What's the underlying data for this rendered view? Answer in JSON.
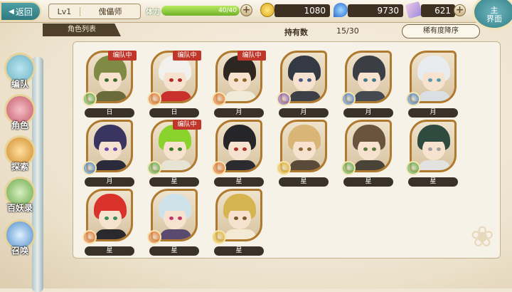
{
  "header": {
    "back_label": "返回",
    "level": "Lv1",
    "player_name": "傀儡师",
    "stamina_label": "体力",
    "stamina_value": "40/40",
    "stamina_fraction": 1.0,
    "gold": "1080",
    "gems": "9730",
    "tickets": "621",
    "home_label_1": "主",
    "home_label_2": "界面"
  },
  "tabs": {
    "list_label": "角色列表",
    "owned_label": "持有数",
    "owned_value": "15/30",
    "sort_label": "稀有度降序"
  },
  "sidebar": {
    "items": [
      {
        "label": "编队",
        "icon": "team-icon"
      },
      {
        "label": "角色",
        "icon": "character-icon"
      },
      {
        "label": "探索",
        "icon": "explore-icon"
      },
      {
        "label": "百妖录",
        "icon": "bestiary-icon"
      },
      {
        "label": "召唤",
        "icon": "summon-icon"
      }
    ]
  },
  "in_team_label": "编队中",
  "characters": [
    {
      "name": "日",
      "in_team": true,
      "hair": "#7f8a45",
      "eye": "#3b6b2a",
      "attr": "#4aa63a",
      "cloth": "#6b6a3a"
    },
    {
      "name": "日",
      "in_team": true,
      "hair": "#f2f0ec",
      "eye": "#b22a2a",
      "attr": "#e06a1e",
      "cloth": "#c9302c"
    },
    {
      "name": "月",
      "in_team": true,
      "hair": "#2e2620",
      "eye": "#8a6a2a",
      "attr": "#e06a1e",
      "cloth": "#f0ead8"
    },
    {
      "name": "月",
      "in_team": false,
      "hair": "#343a44",
      "eye": "#4a5a8a",
      "attr": "#7a4ab0",
      "cloth": "#3c3f46"
    },
    {
      "name": "月",
      "in_team": false,
      "hair": "#3b3e44",
      "eye": "#3e7a8a",
      "attr": "#3a7ac6",
      "cloth": "#444a50"
    },
    {
      "name": "月",
      "in_team": false,
      "hair": "#e8ecef",
      "eye": "#5a9ab0",
      "attr": "#3a7ac6",
      "cloth": "#d9dfe2"
    },
    {
      "name": "月",
      "in_team": false,
      "hair": "#3a3560",
      "eye": "#6a4ab0",
      "attr": "#3a7ac6",
      "cloth": "#2b2a3a"
    },
    {
      "name": "星",
      "in_team": true,
      "hair": "#8ad22c",
      "eye": "#3a7a2a",
      "attr": "#4aa63a",
      "cloth": "#e8e4d4"
    },
    {
      "name": "星",
      "in_team": false,
      "hair": "#262628",
      "eye": "#b03028",
      "attr": "#e06a1e",
      "cloth": "#2c2c30"
    },
    {
      "name": "星",
      "in_team": false,
      "hair": "#d9b677",
      "eye": "#8a6a3a",
      "attr": "#e0b21e",
      "cloth": "#5a4a3a"
    },
    {
      "name": "星",
      "in_team": false,
      "hair": "#6a5440",
      "eye": "#5a7a3a",
      "attr": "#4aa63a",
      "cloth": "#4a4438"
    },
    {
      "name": "星",
      "in_team": false,
      "hair": "#2f4a3e",
      "eye": "#a0a0a0",
      "attr": "#4aa63a",
      "cloth": "#e2e2e0"
    },
    {
      "name": "星",
      "in_team": false,
      "hair": "#d8322a",
      "eye": "#3a8a5a",
      "attr": "#e06a1e",
      "cloth": "#2a2a2e"
    },
    {
      "name": "星",
      "in_team": false,
      "hair": "#cfe2ea",
      "eye": "#c03a6a",
      "attr": "#e06a1e",
      "cloth": "#5a4a70"
    },
    {
      "name": "星",
      "in_team": false,
      "hair": "#d6b450",
      "eye": "#7a5a2a",
      "attr": "#e0b21e",
      "cloth": "#f2ead2"
    }
  ]
}
